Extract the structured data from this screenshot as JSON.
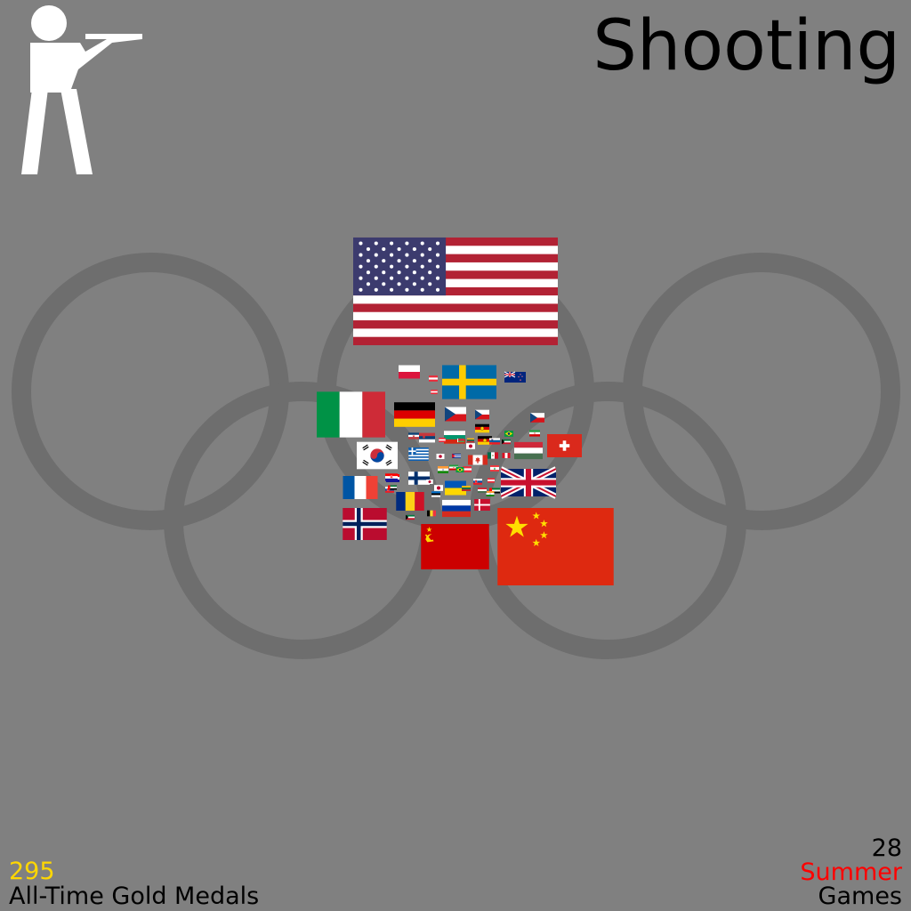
{
  "header": {
    "title": "Shooting"
  },
  "stats": {
    "gold_total": "295",
    "gold_label": "All-Time Gold Medals",
    "games_count": "28",
    "games_season": "Summer",
    "games_word": "Games"
  },
  "icon": {
    "name": "rifle-shooter-pictogram-icon"
  },
  "colors": {
    "background": "#808080",
    "rings": "#6e6e6e",
    "gold_number": "#ffd700",
    "summer_word": "#ff0000",
    "text": "#000000"
  },
  "chart_data": {
    "type": "proportional-flag-area",
    "measure": "gold medals",
    "series": [
      {
        "flag": "usa",
        "value": 57
      },
      {
        "flag": "china",
        "value": 26
      },
      {
        "flag": "italy",
        "value": 15
      },
      {
        "flag": "sweden",
        "value": 14
      },
      {
        "flag": "great-britain",
        "value": 13
      },
      {
        "flag": "soviet-union",
        "value": 12
      },
      {
        "flag": "norway",
        "value": 10
      },
      {
        "flag": "germany",
        "value": 8
      },
      {
        "flag": "south-korea",
        "value": 8
      },
      {
        "flag": "france",
        "value": 7
      },
      {
        "flag": "romania",
        "value": 6
      },
      {
        "flag": "hungary",
        "value": 5
      },
      {
        "flag": "switzerland",
        "value": 5
      },
      {
        "flag": "russia",
        "value": 5
      },
      {
        "flag": "poland",
        "value": 3
      },
      {
        "flag": "czech-republic",
        "value": 3
      },
      {
        "flag": "ukraine",
        "value": 3
      },
      {
        "flag": "finland",
        "value": 3
      },
      {
        "flag": "greece",
        "value": 3
      },
      {
        "flag": "new-zealand",
        "value": 2
      },
      {
        "flag": "bulgaria",
        "value": 2
      },
      {
        "flag": "canada",
        "value": 2
      },
      {
        "flag": "czechoslovakia",
        "value": 2
      },
      {
        "flag": "denmark",
        "value": 2
      },
      {
        "flag": "croatia",
        "value": 2
      }
    ]
  }
}
